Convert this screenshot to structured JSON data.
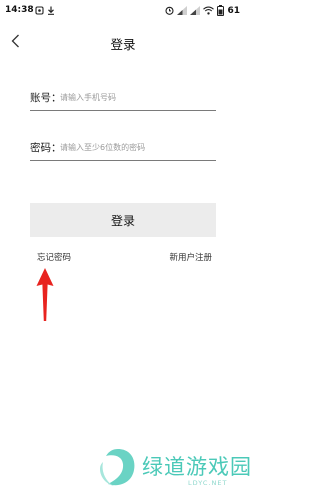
{
  "status_bar": {
    "time": "14:38",
    "battery": "61",
    "icons": [
      "notification-icon",
      "download-icon",
      "alarm-icon",
      "signal-icon",
      "signal-icon",
      "wifi-icon",
      "battery-icon"
    ]
  },
  "nav": {
    "title": "登录",
    "back_icon": "back-chevron-icon"
  },
  "form": {
    "account": {
      "label": "账号：",
      "placeholder": "请输入手机号码",
      "value": ""
    },
    "password": {
      "label": "密码：",
      "placeholder": "请输入至少6位数的密码",
      "value": ""
    },
    "login_button": "登录",
    "forgot_password": "忘记密码",
    "register": "新用户注册"
  },
  "annotation": {
    "arrow_color": "#e8231f",
    "points_to": "forgot_password"
  },
  "watermark": {
    "text": "绿道游戏园",
    "sub": "LDYC.NET",
    "color": "#4bc9b8"
  }
}
